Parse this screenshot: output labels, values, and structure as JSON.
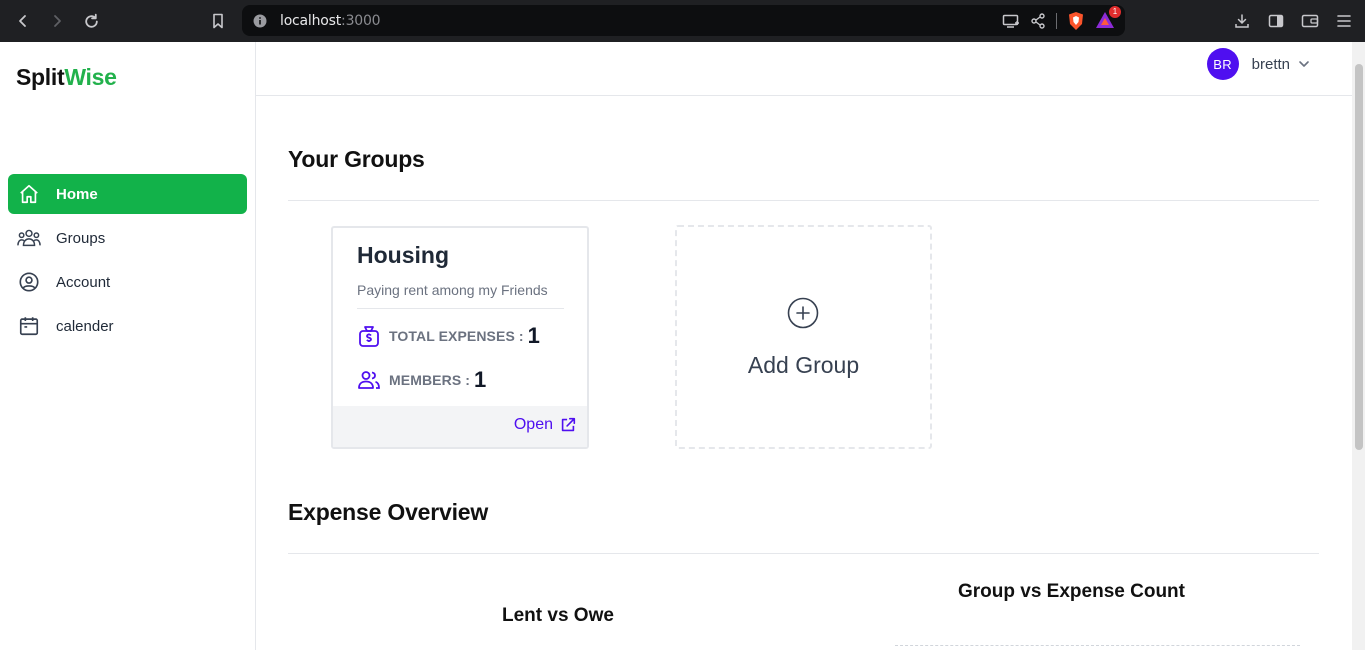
{
  "browser": {
    "url_host": "localhost",
    "url_port": ":3000",
    "notification_count": "1"
  },
  "app": {
    "brand_part1": "Split",
    "brand_part2": "Wise",
    "accent_color": "#12b24a",
    "primary_color": "#4f0ff0"
  },
  "sidebar": {
    "items": [
      {
        "label": "Home",
        "icon": "home-icon",
        "active": true
      },
      {
        "label": "Groups",
        "icon": "users-icon",
        "active": false
      },
      {
        "label": "Account",
        "icon": "user-circle-icon",
        "active": false
      },
      {
        "label": "calender",
        "icon": "calendar-icon",
        "active": false
      }
    ]
  },
  "header": {
    "avatar_initials": "BR",
    "username": "brettn"
  },
  "groups_section": {
    "title": "Your Groups",
    "groups": [
      {
        "name": "Housing",
        "description": "Paying rent among my Friends",
        "total_expenses_label": "TOTAL EXPENSES :",
        "total_expenses_value": "1",
        "members_label": "MEMBERS :",
        "members_value": "1",
        "open_label": "Open"
      }
    ],
    "add_group_label": "Add Group"
  },
  "overview_section": {
    "title": "Expense Overview",
    "charts": [
      {
        "title": "Lent vs Owe"
      },
      {
        "title": "Group vs Expense Count"
      }
    ]
  }
}
